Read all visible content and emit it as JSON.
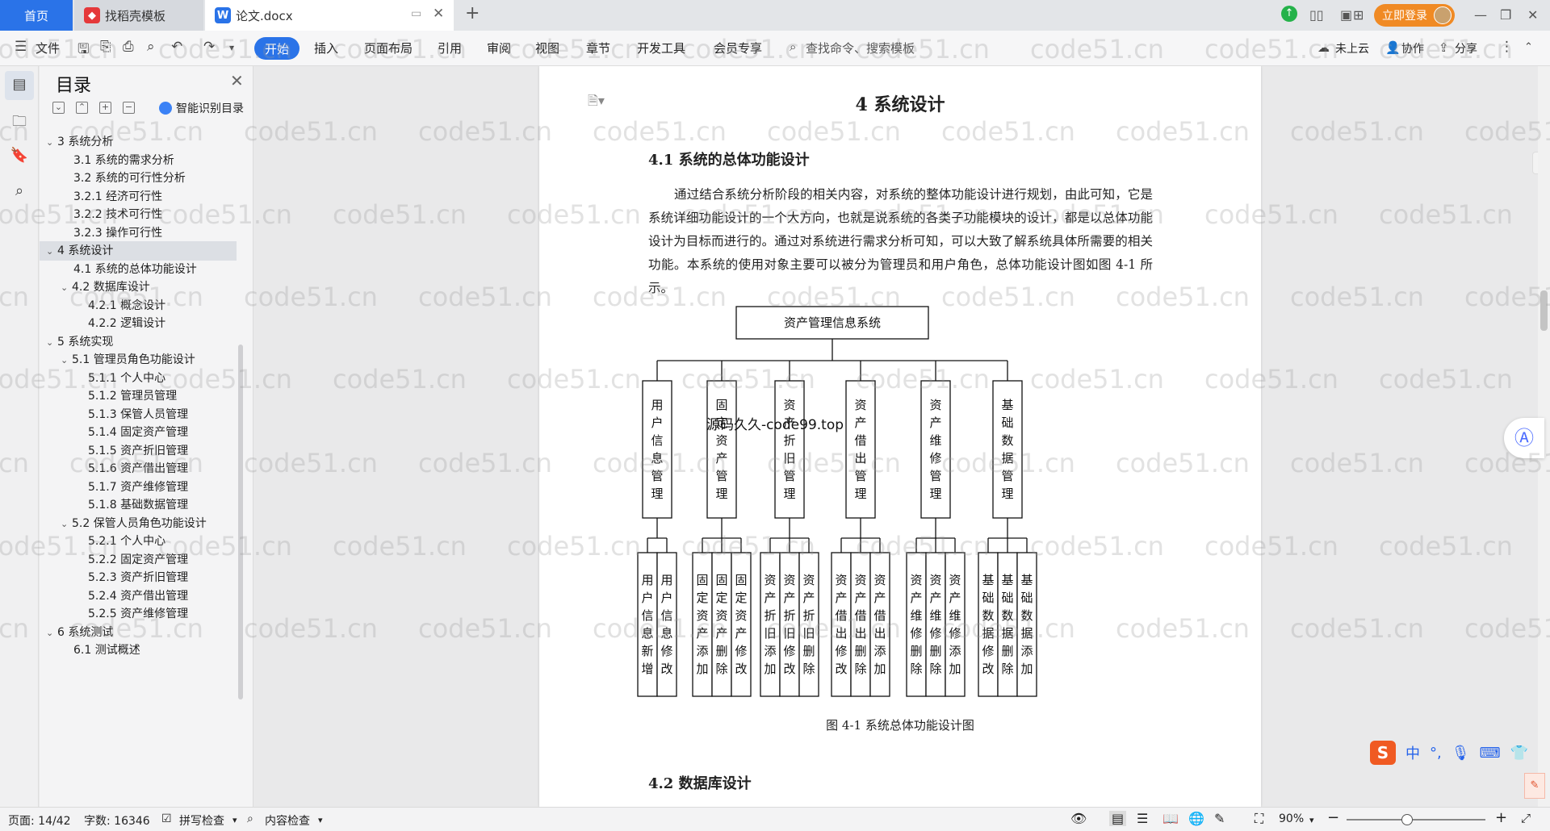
{
  "titlebar": {
    "tab_home": "首页",
    "tab_template": "找稻壳模板",
    "tab_doc": "论文.docx",
    "login_label": "立即登录"
  },
  "ribbon": {
    "file_label": "文件",
    "menus": [
      "开始",
      "插入",
      "页面布局",
      "引用",
      "审阅",
      "视图",
      "章节",
      "开发工具",
      "会员专享"
    ],
    "search_placeholder": "查找命令、搜索模板",
    "cloud_label": "未上云",
    "collab_label": "协作",
    "share_label": "分享"
  },
  "toc": {
    "title": "目录",
    "ai_label": "智能识别目录",
    "items": [
      {
        "label": "3  系统分析",
        "level": 1,
        "arrow": "expanded"
      },
      {
        "label": "3.1  系统的需求分析",
        "level": 2
      },
      {
        "label": "3.2  系统的可行性分析",
        "level": 2
      },
      {
        "label": "3.2.1  经济可行性",
        "level": 2
      },
      {
        "label": "3.2.2  技术可行性",
        "level": 2
      },
      {
        "label": "3.2.3  操作可行性",
        "level": 2
      },
      {
        "label": "4  系统设计",
        "level": 1,
        "arrow": "expanded",
        "selected": true
      },
      {
        "label": "4.1  系统的总体功能设计",
        "level": 2
      },
      {
        "label": "4.2  数据库设计",
        "level": 2,
        "arrow": "expanded"
      },
      {
        "label": "4.2.1  概念设计",
        "level": 3
      },
      {
        "label": "4.2.2 逻辑设计",
        "level": 3
      },
      {
        "label": "5  系统实现",
        "level": 1,
        "arrow": "expanded"
      },
      {
        "label": "5.1  管理员角色功能设计",
        "level": 2,
        "arrow": "expanded"
      },
      {
        "label": "5.1.1  个人中心",
        "level": 3
      },
      {
        "label": "5.1.2  管理员管理",
        "level": 3
      },
      {
        "label": "5.1.3  保管人员管理",
        "level": 3
      },
      {
        "label": "5.1.4  固定资产管理",
        "level": 3
      },
      {
        "label": "5.1.5  资产折旧管理",
        "level": 3
      },
      {
        "label": "5.1.6  资产借出管理",
        "level": 3
      },
      {
        "label": "5.1.7  资产维修管理",
        "level": 3
      },
      {
        "label": "5.1.8  基础数据管理",
        "level": 3
      },
      {
        "label": "5.2  保管人员角色功能设计",
        "level": 2,
        "arrow": "expanded"
      },
      {
        "label": "5.2.1  个人中心",
        "level": 3
      },
      {
        "label": "5.2.2  固定资产管理",
        "level": 3
      },
      {
        "label": "5.2.3  资产折旧管理",
        "level": 3
      },
      {
        "label": "5.2.4  资产借出管理",
        "level": 3
      },
      {
        "label": "5.2.5  资产维修管理",
        "level": 3
      },
      {
        "label": "6  系统测试",
        "level": 1,
        "arrow": "expanded"
      },
      {
        "label": "6.1 测试概述",
        "level": 2
      }
    ]
  },
  "document": {
    "chapter_title": "4  系统设计",
    "section_41": "4.1  系统的总体功能设计",
    "paragraph": "通过结合系统分析阶段的相关内容，对系统的整体功能设计进行规划，由此可知，它是系统详细功能设计的一个大方向，也就是说系统的各类子功能模块的设计，都是以总体功能设计为目标而进行的。通过对系统进行需求分析可知，可以大致了解系统具体所需要的相关功能。本系统的使用对象主要可以被分为管理员和用户角色，总体功能设计图如图 4-1 所示。",
    "figure_caption": "图 4-1 系统总体功能设计图",
    "section_42": "4.2  数据库设计",
    "source_watermark": "源码久久-code99.top"
  },
  "diagram": {
    "root": "资产管理信息系统",
    "modules": [
      {
        "name": "用户信息管理",
        "children": [
          "用户信息新增",
          "用户信息修改"
        ]
      },
      {
        "name": "固定资产管理",
        "children": [
          "固定资产添加",
          "固定资产删除",
          "固定资产修改"
        ]
      },
      {
        "name": "资产折旧管理",
        "children": [
          "资产折旧添加",
          "资产折旧修改",
          "资产折旧删除"
        ]
      },
      {
        "name": "资产借出管理",
        "children": [
          "资产借出修改",
          "资产借出删除",
          "资产借出添加"
        ]
      },
      {
        "name": "资产维修管理",
        "children": [
          "资产维修删除",
          "资产维修删除",
          "资产维修添加"
        ]
      },
      {
        "name": "基础数据管理",
        "children": [
          "基础数据修改",
          "基础数据删除",
          "基础数据添加"
        ]
      }
    ]
  },
  "watermark_text": "code51.cn",
  "ime": {
    "lang": "中"
  },
  "statusbar": {
    "page": "页面: 14/42",
    "words": "字数: 16346",
    "spell": "拼写检查",
    "content_check": "内容检查",
    "zoom": "90%"
  },
  "colors": {
    "accent": "#2a73e8",
    "login": "#f08a24"
  }
}
